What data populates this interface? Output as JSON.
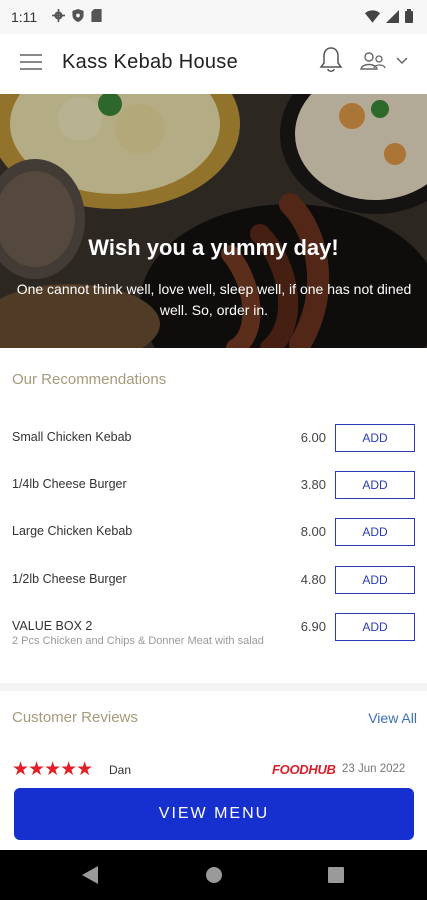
{
  "status_bar": {
    "time": "1:11"
  },
  "header": {
    "title": "Kass Kebab House"
  },
  "hero": {
    "title": "Wish you a yummy day!",
    "subtitle": "One cannot think well, love well, sleep well, if one has not dined well. So, order in."
  },
  "recommendations": {
    "title": "Our Recommendations",
    "add_label": "ADD",
    "items": [
      {
        "name": "Small Chicken Kebab",
        "price": "6.00",
        "description": ""
      },
      {
        "name": "1/4lb Cheese Burger",
        "price": "3.80",
        "description": ""
      },
      {
        "name": "Large Chicken Kebab",
        "price": "8.00",
        "description": ""
      },
      {
        "name": "1/2lb Cheese Burger",
        "price": "4.80",
        "description": ""
      },
      {
        "name": "VALUE BOX 2",
        "price": "6.90",
        "description": "2 Pcs Chicken and Chips & Donner Meat with salad"
      }
    ]
  },
  "reviews": {
    "title": "Customer Reviews",
    "view_all": "View All",
    "items": [
      {
        "stars": "★★★★★",
        "rating": 5,
        "reviewer": "Dan",
        "source": "FOODHUB",
        "date": "23 Jun 2022"
      }
    ]
  },
  "cta": {
    "view_menu": "VIEW MENU"
  },
  "colors": {
    "accent": "#1530cf",
    "section_title": "#a79a7b",
    "star": "#e0202a"
  }
}
